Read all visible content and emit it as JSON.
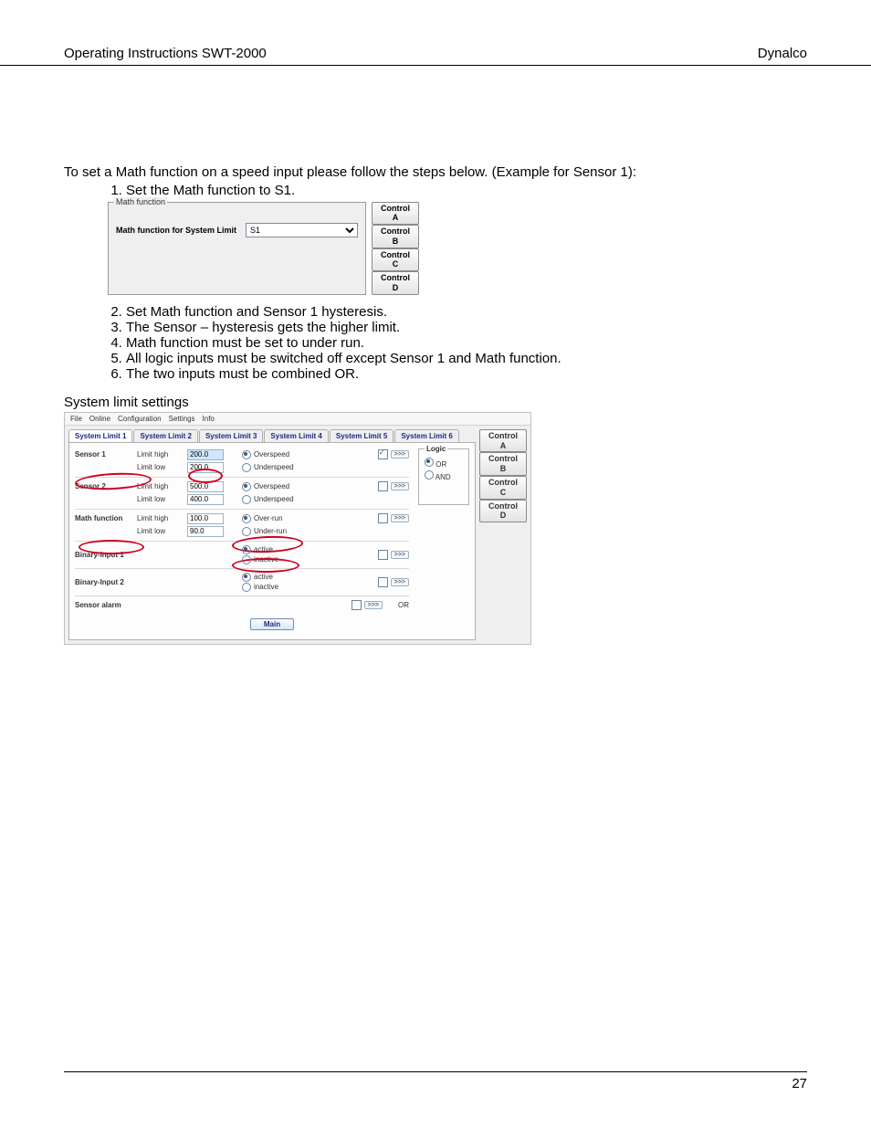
{
  "header": {
    "left": "Operating Instructions SWT-2000",
    "right": "Dynalco"
  },
  "intro": "To set a Math function on a speed input please follow the steps below. (Example for Sensor 1):",
  "step1": "Set the Math function to S1.",
  "panel1": {
    "legend": "Math function",
    "label": "Math function for System Limit",
    "value": "S1",
    "controls": [
      "Control A",
      "Control B",
      "Control C",
      "Control D"
    ]
  },
  "steps_rest": [
    "Set Math function and Sensor 1 hysteresis.",
    "The Sensor – hysteresis gets the higher limit.",
    "Math function must be set to under run.",
    "All logic inputs must be switched off except Sensor 1 and Math function.",
    "The two inputs must be combined OR."
  ],
  "section2_title": "System limit settings",
  "panel2": {
    "menu": [
      "File",
      "Online",
      "Configuration",
      "Settings",
      "Info"
    ],
    "tabs": [
      "System Limit 1",
      "System Limit 2",
      "System Limit 3",
      "System Limit 4",
      "System Limit 5",
      "System Limit 6"
    ],
    "controls": [
      "Control A",
      "Control B",
      "Control C",
      "Control D"
    ],
    "logic": {
      "title": "Logic",
      "opt1": "OR",
      "opt2": "AND"
    },
    "moreLabel": ">>>",
    "rows": {
      "sensor1": {
        "name": "Sensor 1",
        "hi_label": "Limit high",
        "hi_val": "200.0",
        "lo_label": "Limit low",
        "lo_val": "200.0",
        "r1": "Overspeed",
        "r2": "Underspeed"
      },
      "sensor2": {
        "name": "Sensor 2",
        "hi_label": "Limit high",
        "hi_val": "500.0",
        "lo_label": "Limit low",
        "lo_val": "400.0",
        "r1": "Overspeed",
        "r2": "Underspeed"
      },
      "mathf": {
        "name": "Math function",
        "hi_label": "Limit high",
        "hi_val": "100.0",
        "lo_label": "Limit low",
        "lo_val": "90.0",
        "r1": "Over-run",
        "r2": "Under-run"
      },
      "bin1": {
        "name": "Binary-Input 1",
        "r1": "active",
        "r2": "inactive"
      },
      "bin2": {
        "name": "Binary-Input 2",
        "r1": "active",
        "r2": "inactive"
      },
      "alarm": {
        "name": "Sensor alarm",
        "logic": "OR"
      }
    },
    "mainButton": "Main"
  },
  "pageNumber": "27"
}
